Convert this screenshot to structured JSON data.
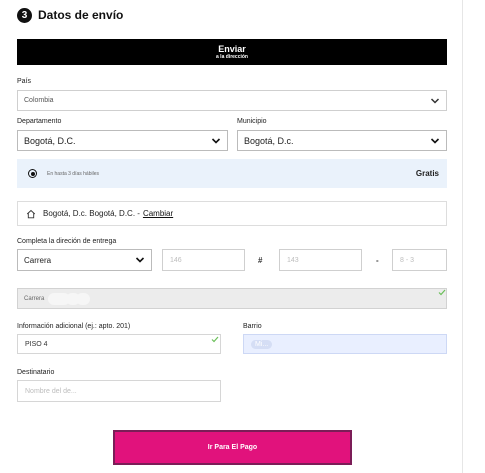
{
  "step": {
    "number": "3",
    "title": "Datos de envío"
  },
  "send_button": {
    "line1": "Enviar",
    "line2": "a la dirección"
  },
  "country": {
    "label": "País",
    "value": "Colombia"
  },
  "department": {
    "label": "Departamento",
    "value": "Bogotá, D.C."
  },
  "municipality": {
    "label": "Municipio",
    "value": "Bogotá, D.c."
  },
  "delivery_option": {
    "text": "En hasta 3 días hábiles",
    "price": "Gratis"
  },
  "address_summary": {
    "text": "Bogotá, D.c. Bogotá, D.C. -",
    "change_link": "Cambiar"
  },
  "address_form": {
    "label": "Completa la direción de entrega",
    "street_type": "Carrera",
    "number1": "146",
    "hash": "#",
    "number2": "143",
    "dash": "-",
    "number3": "8 - 3"
  },
  "readonly_address": {
    "prefix": "Carrera"
  },
  "additional_info": {
    "label": "Información adicional (ej.: apto. 201)",
    "value": "PISO 4"
  },
  "neighborhood": {
    "label": "Barrio",
    "value": "Mi..."
  },
  "recipient": {
    "label": "Destinatario",
    "placeholder": "Nombre del de..."
  },
  "pay_button": {
    "label": "Ir Para El Pago",
    "color": "#e1127c"
  },
  "colors": {
    "delivery_bg": "#eaf2fb",
    "check": "#6bbf5a"
  }
}
